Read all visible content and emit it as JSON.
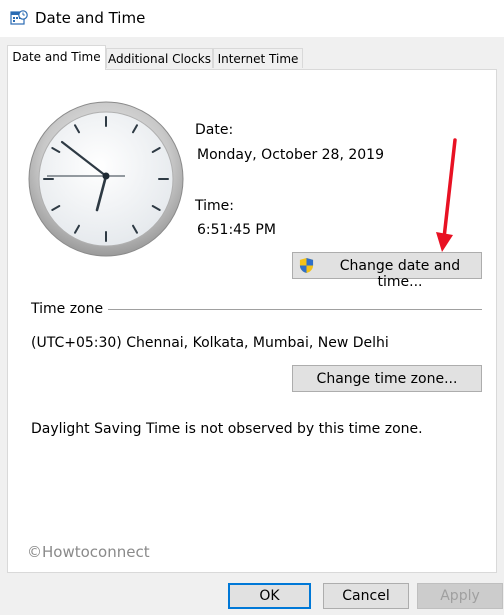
{
  "window": {
    "title": "Date and Time",
    "app_icon": "calendar-clock-icon"
  },
  "tabs": [
    {
      "label": "Date and Time",
      "active": true
    },
    {
      "label": "Additional Clocks",
      "active": false
    },
    {
      "label": "Internet Time",
      "active": false
    }
  ],
  "date_section": {
    "label": "Date:",
    "value": "Monday, October 28, 2019"
  },
  "time_section": {
    "label": "Time:",
    "value": "6:51:45 PM"
  },
  "change_datetime_button": {
    "label": "Change date and time...",
    "icon": "uac-shield-icon"
  },
  "timezone_section": {
    "heading": "Time zone",
    "value": "(UTC+05:30) Chennai, Kolkata, Mumbai, New Delhi",
    "change_button": "Change time zone..."
  },
  "dst_note": "Daylight Saving Time is not observed by this time zone.",
  "watermark": "©Howtoconnect",
  "footer": {
    "ok": "OK",
    "cancel": "Cancel",
    "apply": "Apply",
    "apply_disabled": true
  },
  "colors": {
    "accent": "#0078d7",
    "arrow": "#e81123"
  }
}
